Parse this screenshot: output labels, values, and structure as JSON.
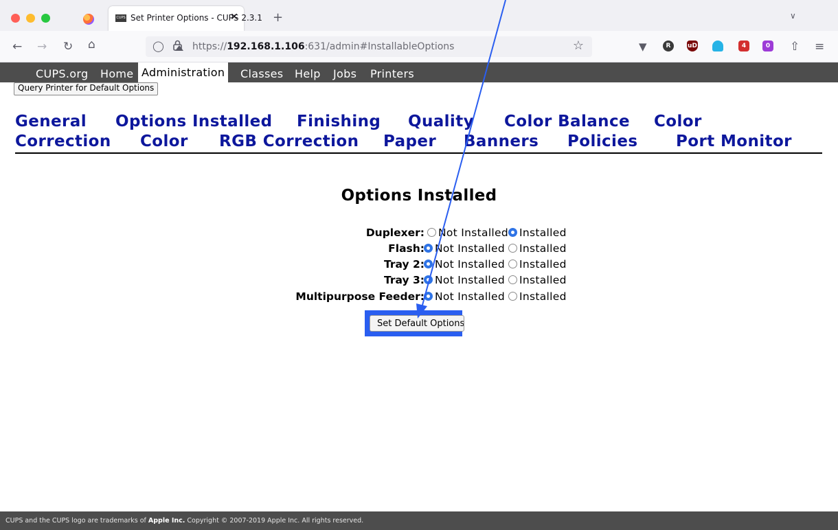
{
  "browser": {
    "tab_title": "Set Printer Options - CUPS 2.3.1",
    "tab_favicon_text": "CUPS",
    "tab_close": "✕",
    "new_tab": "+",
    "url_prefix": "https://",
    "url_host": "192.168.1.106",
    "url_rest": ":631/admin#InstallableOptions"
  },
  "cups_nav": [
    "CUPS.org",
    "Home",
    "Administration",
    "Classes",
    "Help",
    "Jobs",
    "Printers"
  ],
  "query_button": "Query Printer for Default Options",
  "sections_line1": [
    "General",
    "Options Installed",
    "Finishing",
    "Quality",
    "Color Balance",
    "Color"
  ],
  "sections_line2": [
    "Correction",
    "Color",
    "RGB Correction",
    "Paper",
    "Banners",
    "Policies",
    "Port Monitor"
  ],
  "form": {
    "heading": "Options Installed",
    "not_installed": "Not Installed",
    "installed": "Installed",
    "rows": [
      {
        "label": "Duplexer:",
        "value": "Installed"
      },
      {
        "label": "Flash:",
        "value": "Not Installed"
      },
      {
        "label": "Tray 2:",
        "value": "Not Installed"
      },
      {
        "label": "Tray 3:",
        "value": "Not Installed"
      },
      {
        "label": "Multipurpose Feeder:",
        "value": "Not Installed"
      }
    ],
    "submit": "Set Default Options"
  },
  "footer": {
    "prefix": "CUPS and the CUPS logo are trademarks of ",
    "company": "Apple Inc.",
    "suffix": " Copyright © 2007-2019 Apple Inc. All rights reserved."
  },
  "annotation": {
    "color": "#2a5ef0"
  }
}
